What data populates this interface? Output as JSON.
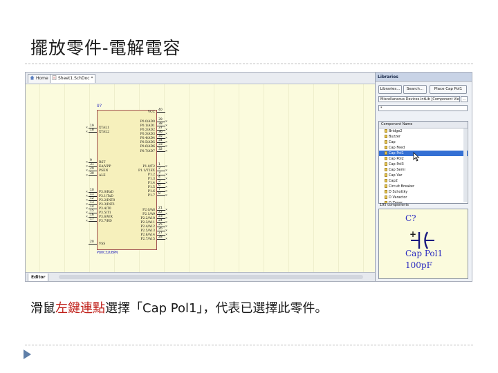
{
  "slide": {
    "title": "擺放零件-電解電容",
    "caption_before": "滑鼠",
    "caption_highlight": "左鍵連點",
    "caption_after": "選擇「Cap Pol1」，代表已選擇此零件。"
  },
  "colors": {
    "highlight": "#c0201a",
    "selection": "#3470d4",
    "sheet": "#fbfbdd",
    "component_text": "#2a2ac0"
  },
  "tabs": {
    "home": "Home",
    "sheet": "Sheet1.SchDoc *"
  },
  "editor_tab": "Editor",
  "component": {
    "designator": "U?",
    "partname": "P80C32UBPN",
    "left_pins": [
      {
        "num": "19",
        "name": "XTAL1"
      },
      {
        "num": "18",
        "name": "XTAL2"
      },
      {
        "num": "9",
        "name": "RST"
      },
      {
        "num": "31",
        "name": "EA/VPP"
      },
      {
        "num": "29",
        "name": "PSEN"
      },
      {
        "num": "30",
        "name": "ALE"
      },
      {
        "num": "10",
        "name": "P3.0/RxD"
      },
      {
        "num": "11",
        "name": "P3.1/TxD"
      },
      {
        "num": "12",
        "name": "P3.2/INT0"
      },
      {
        "num": "13",
        "name": "P3.3/INT1"
      },
      {
        "num": "14",
        "name": "P3.4/T0"
      },
      {
        "num": "15",
        "name": "P3.5/T1"
      },
      {
        "num": "16",
        "name": "P3.6/WR"
      },
      {
        "num": "17",
        "name": "P3.7/RD"
      },
      {
        "num": "20",
        "name": "VSS"
      }
    ],
    "right_pins": [
      {
        "num": "40",
        "name": "VCC"
      },
      {
        "num": "39",
        "name": "P0.0/AD0"
      },
      {
        "num": "38",
        "name": "P0.1/AD1"
      },
      {
        "num": "37",
        "name": "P0.2/AD2"
      },
      {
        "num": "36",
        "name": "P0.3/AD3"
      },
      {
        "num": "35",
        "name": "P0.4/AD4"
      },
      {
        "num": "34",
        "name": "P0.5/AD5"
      },
      {
        "num": "33",
        "name": "P0.6/AD6"
      },
      {
        "num": "32",
        "name": "P0.7/AD7"
      },
      {
        "num": "1",
        "name": "P1.0/T2"
      },
      {
        "num": "2",
        "name": "P1.1/T2EX"
      },
      {
        "num": "3",
        "name": "P1.2"
      },
      {
        "num": "4",
        "name": "P1.3"
      },
      {
        "num": "5",
        "name": "P1.4"
      },
      {
        "num": "6",
        "name": "P1.5"
      },
      {
        "num": "7",
        "name": "P1.6"
      },
      {
        "num": "8",
        "name": "P1.7"
      },
      {
        "num": "21",
        "name": "P2.0/A8"
      },
      {
        "num": "22",
        "name": "P2.1/A9"
      },
      {
        "num": "23",
        "name": "P2.2/A10"
      },
      {
        "num": "24",
        "name": "P2.3/A11"
      },
      {
        "num": "25",
        "name": "P2.4/A12"
      },
      {
        "num": "26",
        "name": "P2.5/A13"
      },
      {
        "num": "27",
        "name": "P2.6/A14"
      },
      {
        "num": "28",
        "name": "P2.7/A15"
      }
    ]
  },
  "libraries": {
    "title": "Libraries",
    "buttons": {
      "libraries": "Libraries...",
      "search": "Search...",
      "place": "Place Cap Pol1"
    },
    "library_select": "Miscellaneous Devices.IntLib [Component View]",
    "filter": "*",
    "list_header": "Component Name",
    "items": [
      "Bridge2",
      "Buzzer",
      "Cap",
      "Cap Feed",
      "Cap Pol1",
      "Cap Pol2",
      "Cap Pol3",
      "Cap Semi",
      "Cap Var",
      "Cap2",
      "Circuit Breaker",
      "D Schottky",
      "D Varactor",
      "D Zener"
    ],
    "selected": "Cap Pol1",
    "count": "195 components",
    "preview": {
      "designator": "C?",
      "name": "Cap Pol1",
      "value": "100pF",
      "plus": "+"
    }
  }
}
